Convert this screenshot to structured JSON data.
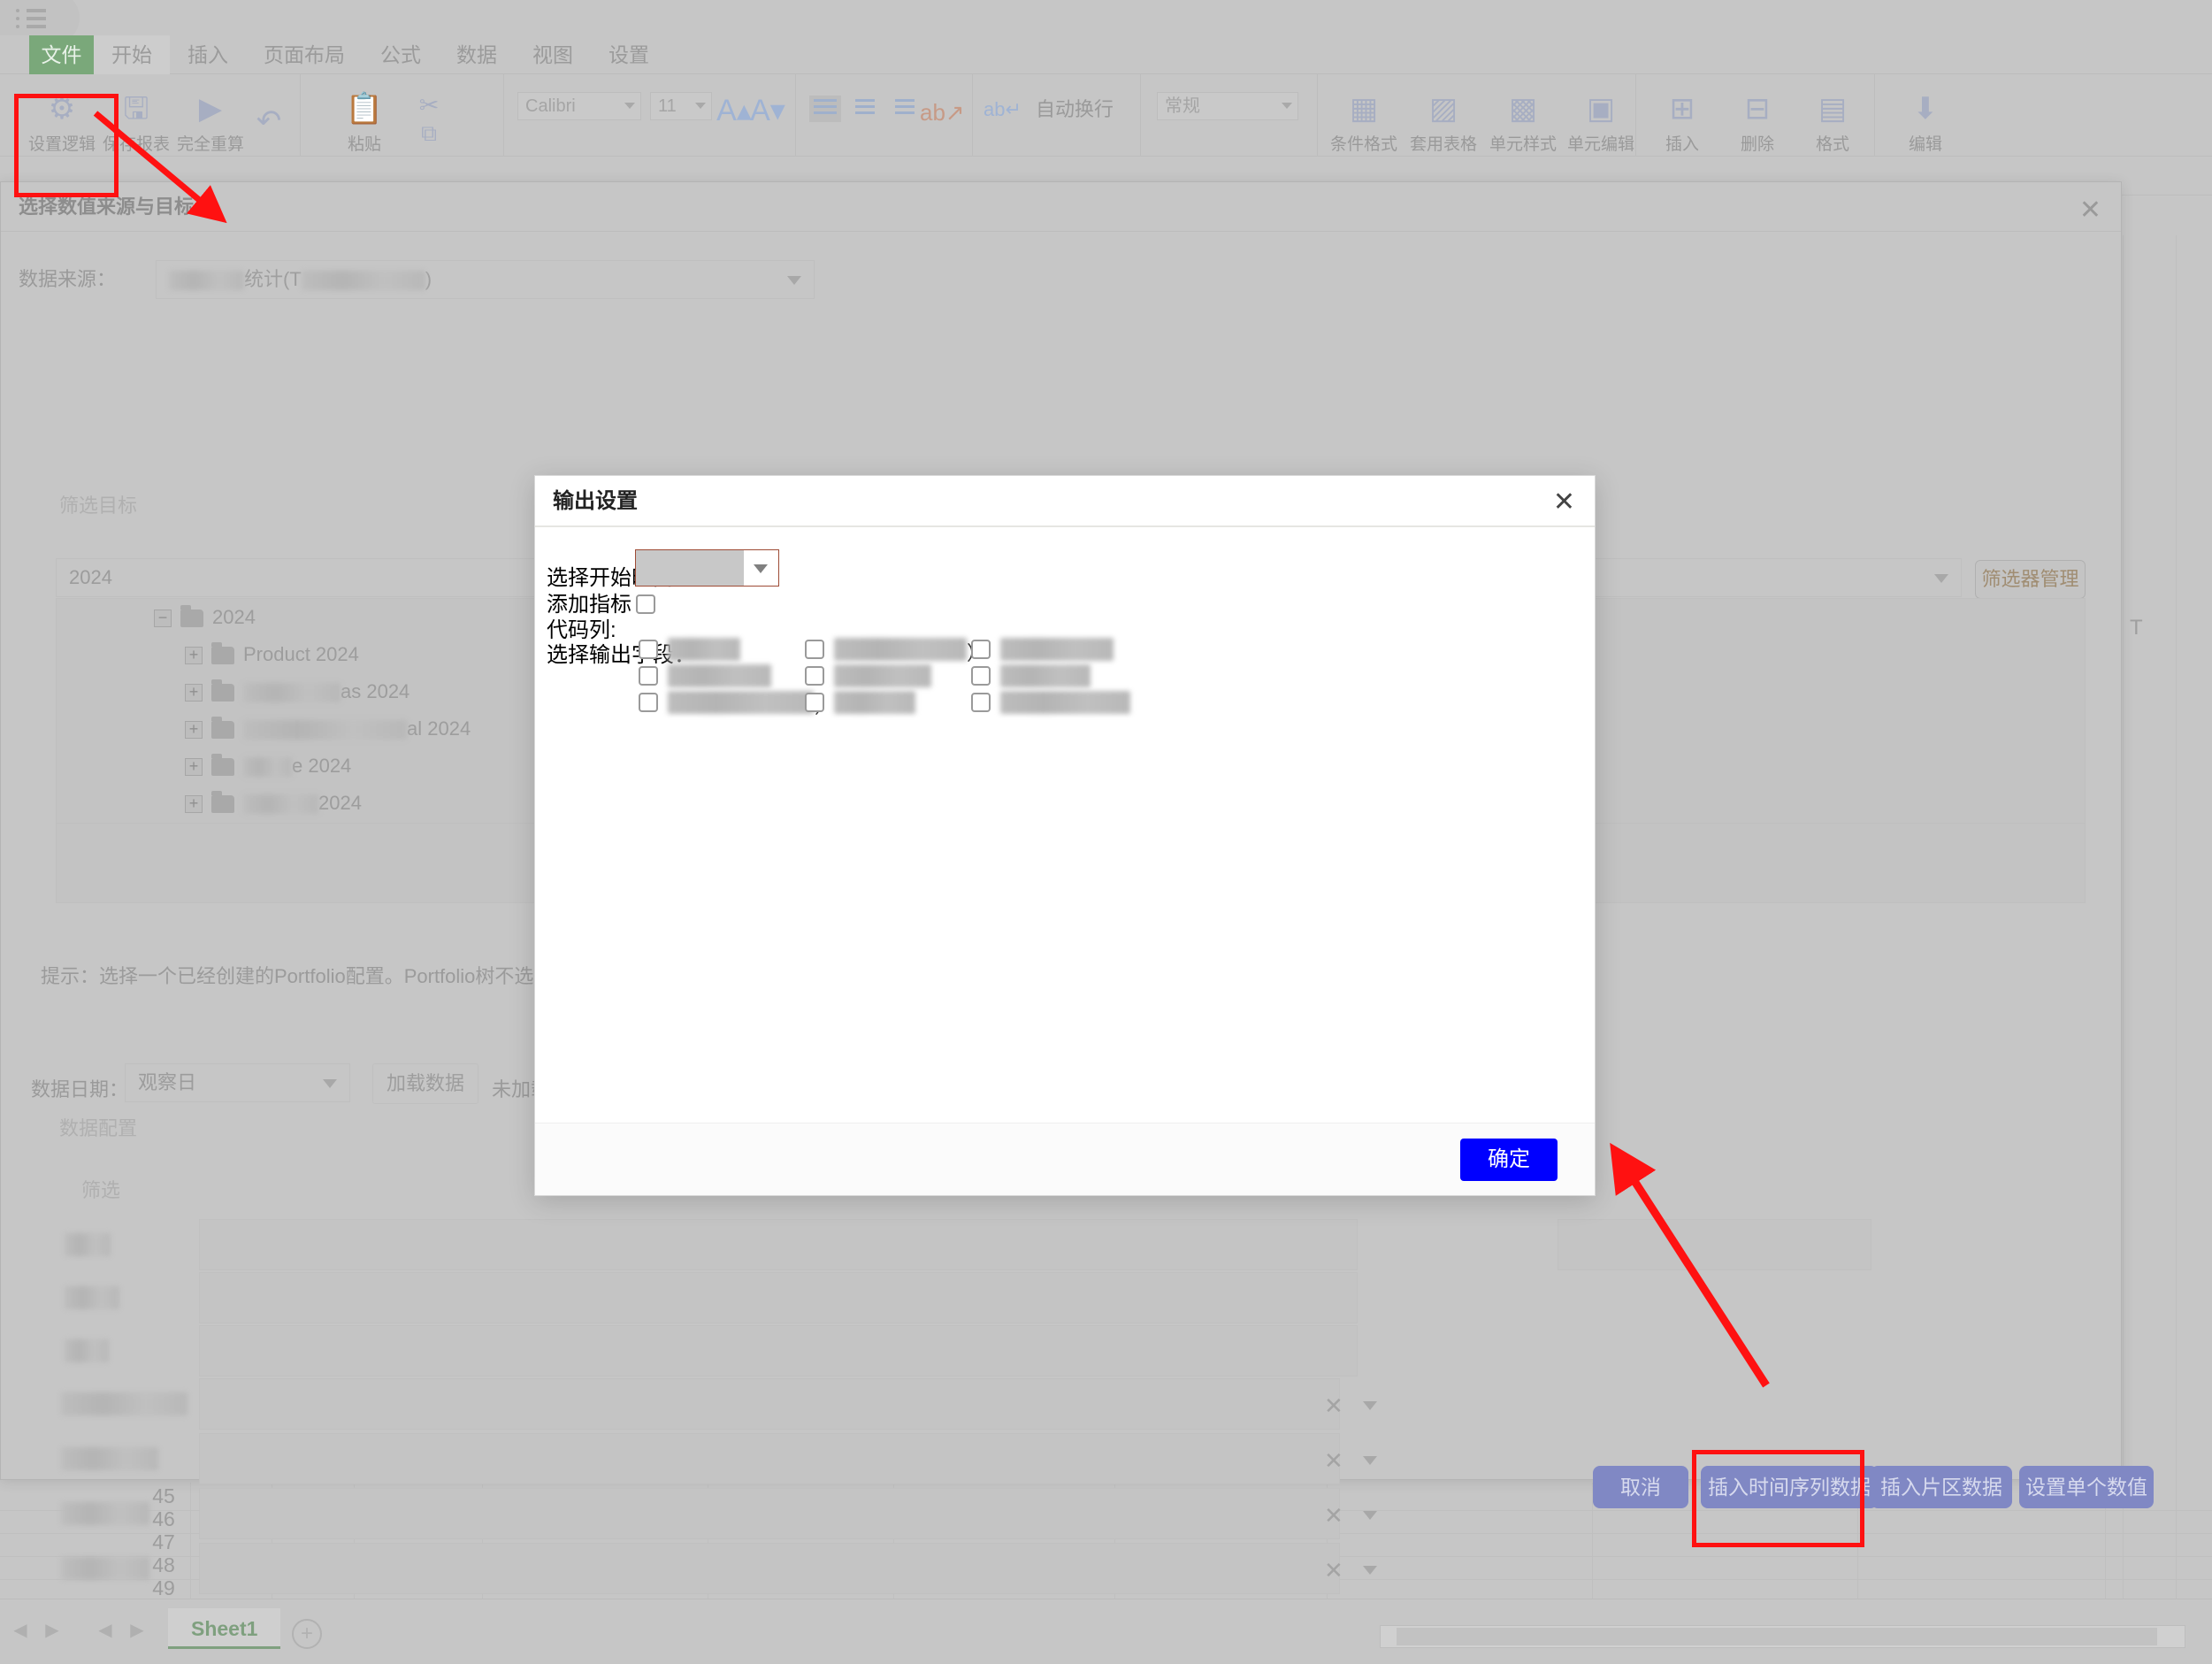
{
  "app": {
    "menu_icon": "hamburger-icon",
    "ribbon_tabs": [
      "文件",
      "开始",
      "插入",
      "页面布局",
      "公式",
      "数据",
      "视图",
      "设置"
    ],
    "ribbon_buttons": [
      {
        "label": "设置逻辑",
        "icon": "logic-settings-icon"
      },
      {
        "label": "保存报表",
        "icon": "save-icon"
      },
      {
        "label": "完全重算",
        "icon": "recalculate-icon"
      },
      {
        "label": "粘贴",
        "icon": "paste-icon"
      },
      {
        "label": "自动换行",
        "icon": "wrap-text-icon"
      },
      {
        "label": "条件格式",
        "icon": "conditional-format-icon"
      },
      {
        "label": "套用表格",
        "icon": "table-style-icon"
      },
      {
        "label": "单元样式",
        "icon": "cell-style-icon"
      },
      {
        "label": "单元编辑",
        "icon": "cell-edit-icon"
      },
      {
        "label": "插入",
        "icon": "insert-cells-icon"
      },
      {
        "label": "删除",
        "icon": "delete-cells-icon"
      },
      {
        "label": "格式",
        "icon": "format-cells-icon"
      },
      {
        "label": "编辑",
        "icon": "edit-icon"
      }
    ],
    "font_name": "Calibri",
    "font_size": "11",
    "number_format": "常规",
    "grow_font_icon": "increase-font-size-icon",
    "shrink_font_icon": "decrease-font-size-icon",
    "undo_icon": "undo-icon",
    "redo_icon": "redo-icon",
    "cut_icon": "scissors-icon",
    "copy_icon": "copy-icon",
    "row_headers": [
      "45",
      "46",
      "47",
      "48",
      "49"
    ],
    "column_letter_visible": "T",
    "sheet_tab": "Sheet1",
    "add_sheet_icon": "plus-circle-icon",
    "nav_first_icon": "nav-first-icon",
    "nav_prev_icon": "nav-prev-icon",
    "nav_next_icon": "nav-next-icon",
    "nav_last_icon": "nav-last-icon"
  },
  "background_dialog": {
    "title": "选择数值来源与目标",
    "close_icon": "close-icon",
    "data_source_label": "数据来源：",
    "data_source_value": "统计(T        )",
    "data_source_redacted": true,
    "filter_target_group": "筛选目标",
    "portfolio_select_value": "2024",
    "filter_manager_button": "筛选器管理",
    "tree": [
      {
        "label": "2024",
        "indent": 0,
        "expander": "−",
        "expanded": true,
        "redacted": false
      },
      {
        "label": "Product 2024",
        "indent": 1,
        "expander": "+",
        "expanded": false,
        "redacted": false
      },
      {
        "label": "as 2024",
        "indent": 1,
        "expander": "+",
        "expanded": false,
        "redacted": true
      },
      {
        "label": "al 2024",
        "indent": 1,
        "expander": "+",
        "expanded": false,
        "redacted": true
      },
      {
        "label": "e 2024",
        "indent": 1,
        "expander": "+",
        "expanded": false,
        "redacted": true
      },
      {
        "label": "2024",
        "indent": 1,
        "expander": "+",
        "expanded": false,
        "redacted": true
      }
    ],
    "hint": "提示：选择一个已经创建的Portfolio配置。Portfolio树不选择任",
    "data_date_label": "数据日期：",
    "data_date_value": "观察日",
    "load_data_button": "加载数据",
    "load_status": "未加载数",
    "data_config_group": "数据配置",
    "filter_group": "筛选",
    "filter_rows": [
      {
        "label_redacted": true,
        "has_clear": false,
        "has_caret": true
      },
      {
        "label_redacted": true,
        "has_clear": false,
        "has_caret": false
      },
      {
        "label_redacted": true,
        "has_clear": false,
        "has_caret": false
      },
      {
        "label_redacted": true,
        "has_clear": true,
        "has_caret": true
      },
      {
        "label_redacted": true,
        "has_clear": true,
        "has_caret": true
      },
      {
        "label_redacted": true,
        "has_clear": true,
        "has_caret": true
      },
      {
        "label_redacted": true,
        "has_clear": true,
        "has_caret": true
      }
    ],
    "footer_buttons": [
      {
        "label": "取消",
        "highlighted": false
      },
      {
        "label": "插入时间序列数据",
        "highlighted": true
      },
      {
        "label": "插入片区数据",
        "highlighted": false
      },
      {
        "label": "设置单个数值",
        "highlighted": false
      }
    ]
  },
  "modal": {
    "title": "输出设置",
    "close_icon": "close-icon",
    "start_time_label": "选择开始时间：",
    "start_time_value": "",
    "start_time_highlighted": true,
    "add_code_column_label": "添加指标代码列:",
    "add_code_column_checked": false,
    "output_fields_label": "选择输出字段：",
    "output_fields": [
      {
        "checked": false,
        "label_redacted": true,
        "suffix": "",
        "col": 0,
        "row": 0
      },
      {
        "checked": false,
        "label_redacted": true,
        "suffix": "",
        "col": 0,
        "row": 1
      },
      {
        "checked": false,
        "label_redacted": true,
        "suffix": "）",
        "col": 0,
        "row": 2
      },
      {
        "checked": false,
        "label_redacted": true,
        "suffix": "）",
        "col": 1,
        "row": 0
      },
      {
        "checked": false,
        "label_redacted": true,
        "suffix": "",
        "col": 1,
        "row": 1
      },
      {
        "checked": false,
        "label_redacted": true,
        "suffix": "",
        "col": 1,
        "row": 2
      },
      {
        "checked": false,
        "label_redacted": true,
        "suffix": "",
        "col": 2,
        "row": 0
      },
      {
        "checked": false,
        "label_redacted": true,
        "suffix": "",
        "col": 2,
        "row": 1
      },
      {
        "checked": false,
        "label_redacted": true,
        "suffix": "",
        "col": 2,
        "row": 2
      }
    ],
    "confirm_button": "确定"
  },
  "annotations": {
    "accent_color": "#ff1111",
    "boxes": [
      "设置逻辑",
      "选择开始时间输入框",
      "插入时间序列数据"
    ],
    "arrows": 2
  }
}
